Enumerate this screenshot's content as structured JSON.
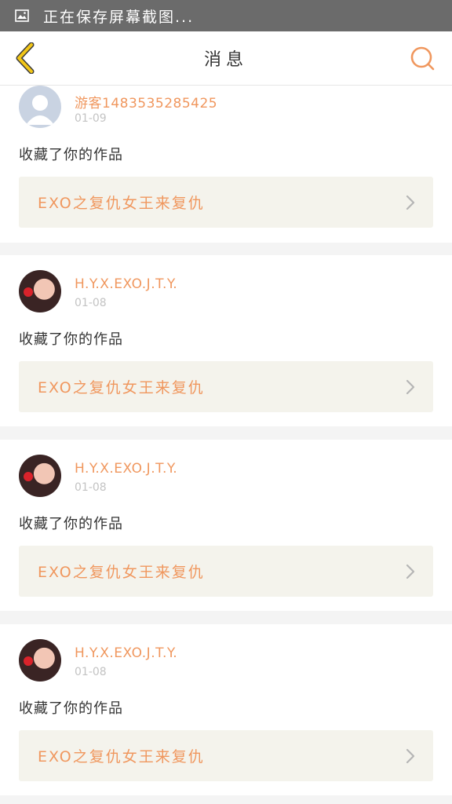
{
  "status_bar": {
    "icon": "image-icon",
    "text": "正在保存屏幕截图..."
  },
  "nav": {
    "title": "消息",
    "back_icon": "chevron-left-icon",
    "search_icon": "search-icon"
  },
  "colors": {
    "accent": "#f0975e",
    "back_icon": "#f2c617",
    "status_bar_bg": "#6b6b6b",
    "work_bg": "#f4f3ec"
  },
  "notifications": [
    {
      "user": "游客1483535285425",
      "date": "01-09",
      "action": "收藏了你的作品",
      "work_title": "EXO之复仇女王来复仇",
      "avatar": "default-avatar"
    },
    {
      "user": "H.Y.X.EXO.J.T.Y.",
      "date": "01-08",
      "action": "收藏了你的作品",
      "work_title": "EXO之复仇女王来复仇",
      "avatar": "photo-avatar"
    },
    {
      "user": "H.Y.X.EXO.J.T.Y.",
      "date": "01-08",
      "action": "收藏了你的作品",
      "work_title": "EXO之复仇女王来复仇",
      "avatar": "photo-avatar"
    },
    {
      "user": "H.Y.X.EXO.J.T.Y.",
      "date": "01-08",
      "action": "收藏了你的作品",
      "work_title": "EXO之复仇女王来复仇",
      "avatar": "photo-avatar"
    }
  ]
}
